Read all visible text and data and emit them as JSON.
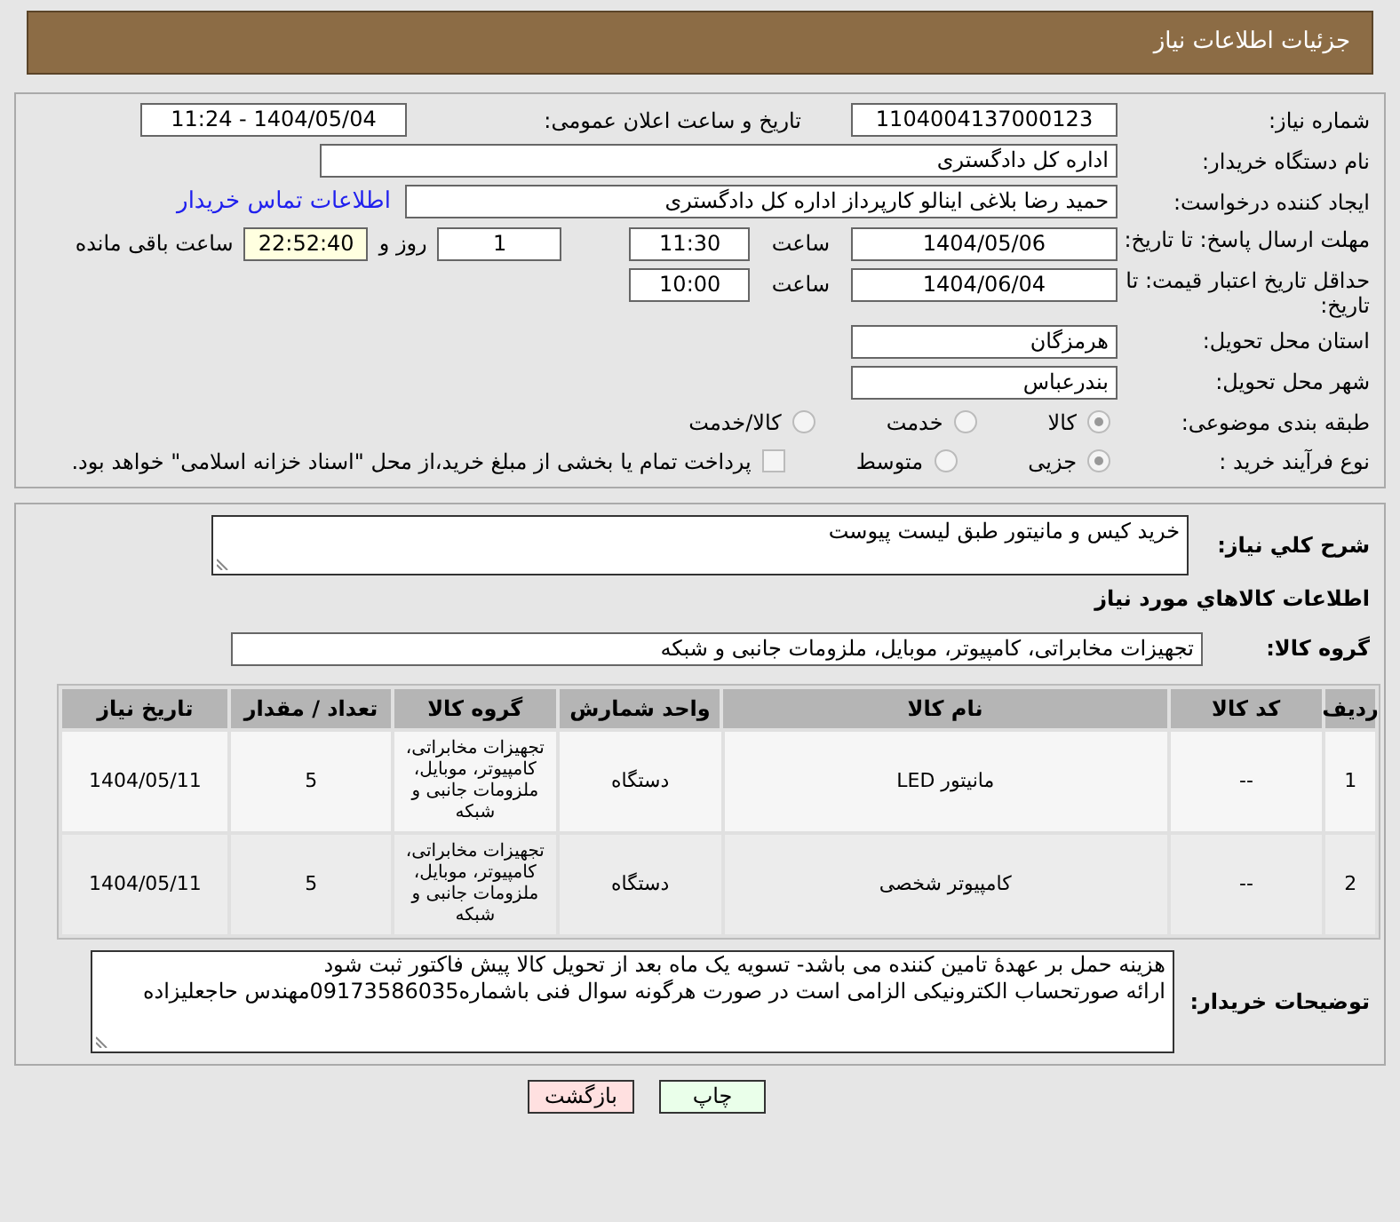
{
  "header": {
    "title": "جزئیات اطلاعات نیاز"
  },
  "need_number": {
    "label": "شماره نیاز:",
    "value": "1104004137000123"
  },
  "announce": {
    "label": "تاریخ و ساعت اعلان عمومی:",
    "value": "1404/05/04 - 11:24"
  },
  "buyer_org": {
    "label": "نام دستگاه خریدار:",
    "value": "اداره کل دادگستری"
  },
  "requester": {
    "label": "ایجاد کننده درخواست:",
    "value": "حمید رضا  بلاغی اینالو کارپرداز اداره کل دادگستری",
    "contact_link": "اطلاعات تماس خریدار"
  },
  "response_deadline": {
    "label": "مهلت ارسال پاسخ: تا تاریخ:",
    "date": "1404/05/06",
    "time_label": "ساعت",
    "time": "11:30",
    "days": "1",
    "days_label": "روز و",
    "remaining": "22:52:40",
    "remaining_label": "ساعت باقی مانده"
  },
  "price_validity": {
    "label": "حداقل تاریخ اعتبار قیمت: تا تاریخ:",
    "date": "1404/06/04",
    "time_label": "ساعت",
    "time": "10:00"
  },
  "province": {
    "label": "استان محل تحویل:",
    "value": "هرمزگان"
  },
  "city": {
    "label": "شهر محل تحویل:",
    "value": "بندرعباس"
  },
  "category": {
    "label": "طبقه بندی موضوعی:",
    "options": [
      {
        "label": "کالا",
        "selected": true
      },
      {
        "label": "خدمت",
        "selected": false
      },
      {
        "label": "کالا/خدمت",
        "selected": false
      }
    ]
  },
  "process": {
    "label": "نوع فرآیند خرید :",
    "options": [
      {
        "label": "جزیی",
        "selected": true
      },
      {
        "label": "متوسط",
        "selected": false
      }
    ],
    "checkbox": {
      "label": "پرداخت تمام یا بخشی از مبلغ خرید،از محل \"اسناد خزانه اسلامی\" خواهد بود.",
      "checked": false
    }
  },
  "description": {
    "label": "شرح كلي نياز:",
    "value": "خرید کیس و مانیتور طبق لیست پیوست"
  },
  "goods_heading": "اطلاعات كالاهاي مورد نياز",
  "goods_group": {
    "label": "گروه کالا:",
    "value": "تجهیزات مخابراتی، کامپیوتر، موبایل، ملزومات جانبی و شبکه"
  },
  "table": {
    "columns": [
      "ردیف",
      "کد کالا",
      "نام کالا",
      "واحد شمارش",
      "گروه کالا",
      "تعداد / مقدار",
      "تاریخ نیاز"
    ],
    "rows": [
      [
        "1",
        "--",
        "مانیتور LED",
        "دستگاه",
        "تجهیزات مخابراتی، کامپیوتر، موبایل، ملزومات جانبی و شبکه",
        "5",
        "1404/05/11"
      ],
      [
        "2",
        "--",
        "کامپیوتر شخصی",
        "دستگاه",
        "تجهیزات مخابراتی، کامپیوتر، موبایل، ملزومات جانبی و شبکه",
        "5",
        "1404/05/11"
      ]
    ]
  },
  "buyer_notes": {
    "label": "توضیحات خریدار:",
    "lines": [
      "هزینه حمل بر عهدۀ تامین کننده می باشد- تسویه یک ماه بعد از تحویل کالا پیش فاکتور ثبت شود",
      "ارائه صورتحساب الکترونیکی الزامی است در صورت هرگونه سوال فنی باشماره09173586035مهندس حاجعلیزاده"
    ]
  },
  "buttons": [
    {
      "label": "چاپ",
      "kind": "print"
    },
    {
      "label": "بازگشت",
      "kind": "back"
    }
  ]
}
